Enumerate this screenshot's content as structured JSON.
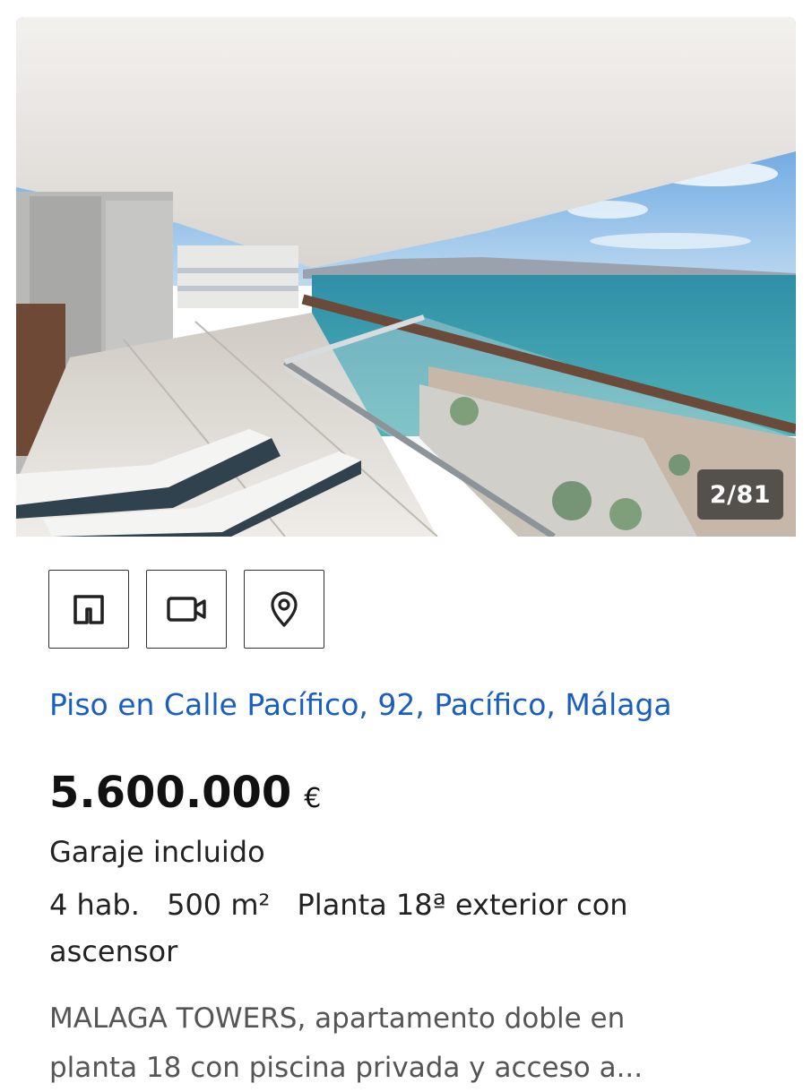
{
  "listing": {
    "photo_counter": "2/81",
    "title": "Piso en Calle Pacífico, 92, Pacífico, Málaga",
    "price": "5.600.000",
    "currency": "€",
    "parking": "Garaje incluido",
    "features": {
      "rooms": "4 hab.",
      "area": "500 m²",
      "floor": "Planta 18ª exterior con ascensor"
    },
    "description_line1": "MALAGA TOWERS, apartamento doble en",
    "description_line2": "planta 18 con piscina privada y acceso a..."
  },
  "actions": [
    {
      "icon": "floor-plan-icon"
    },
    {
      "icon": "video-camera-icon"
    },
    {
      "icon": "map-pin-icon"
    }
  ],
  "colors": {
    "title_link": "#1a5fbf",
    "price": "#111111",
    "description": "#555555"
  }
}
